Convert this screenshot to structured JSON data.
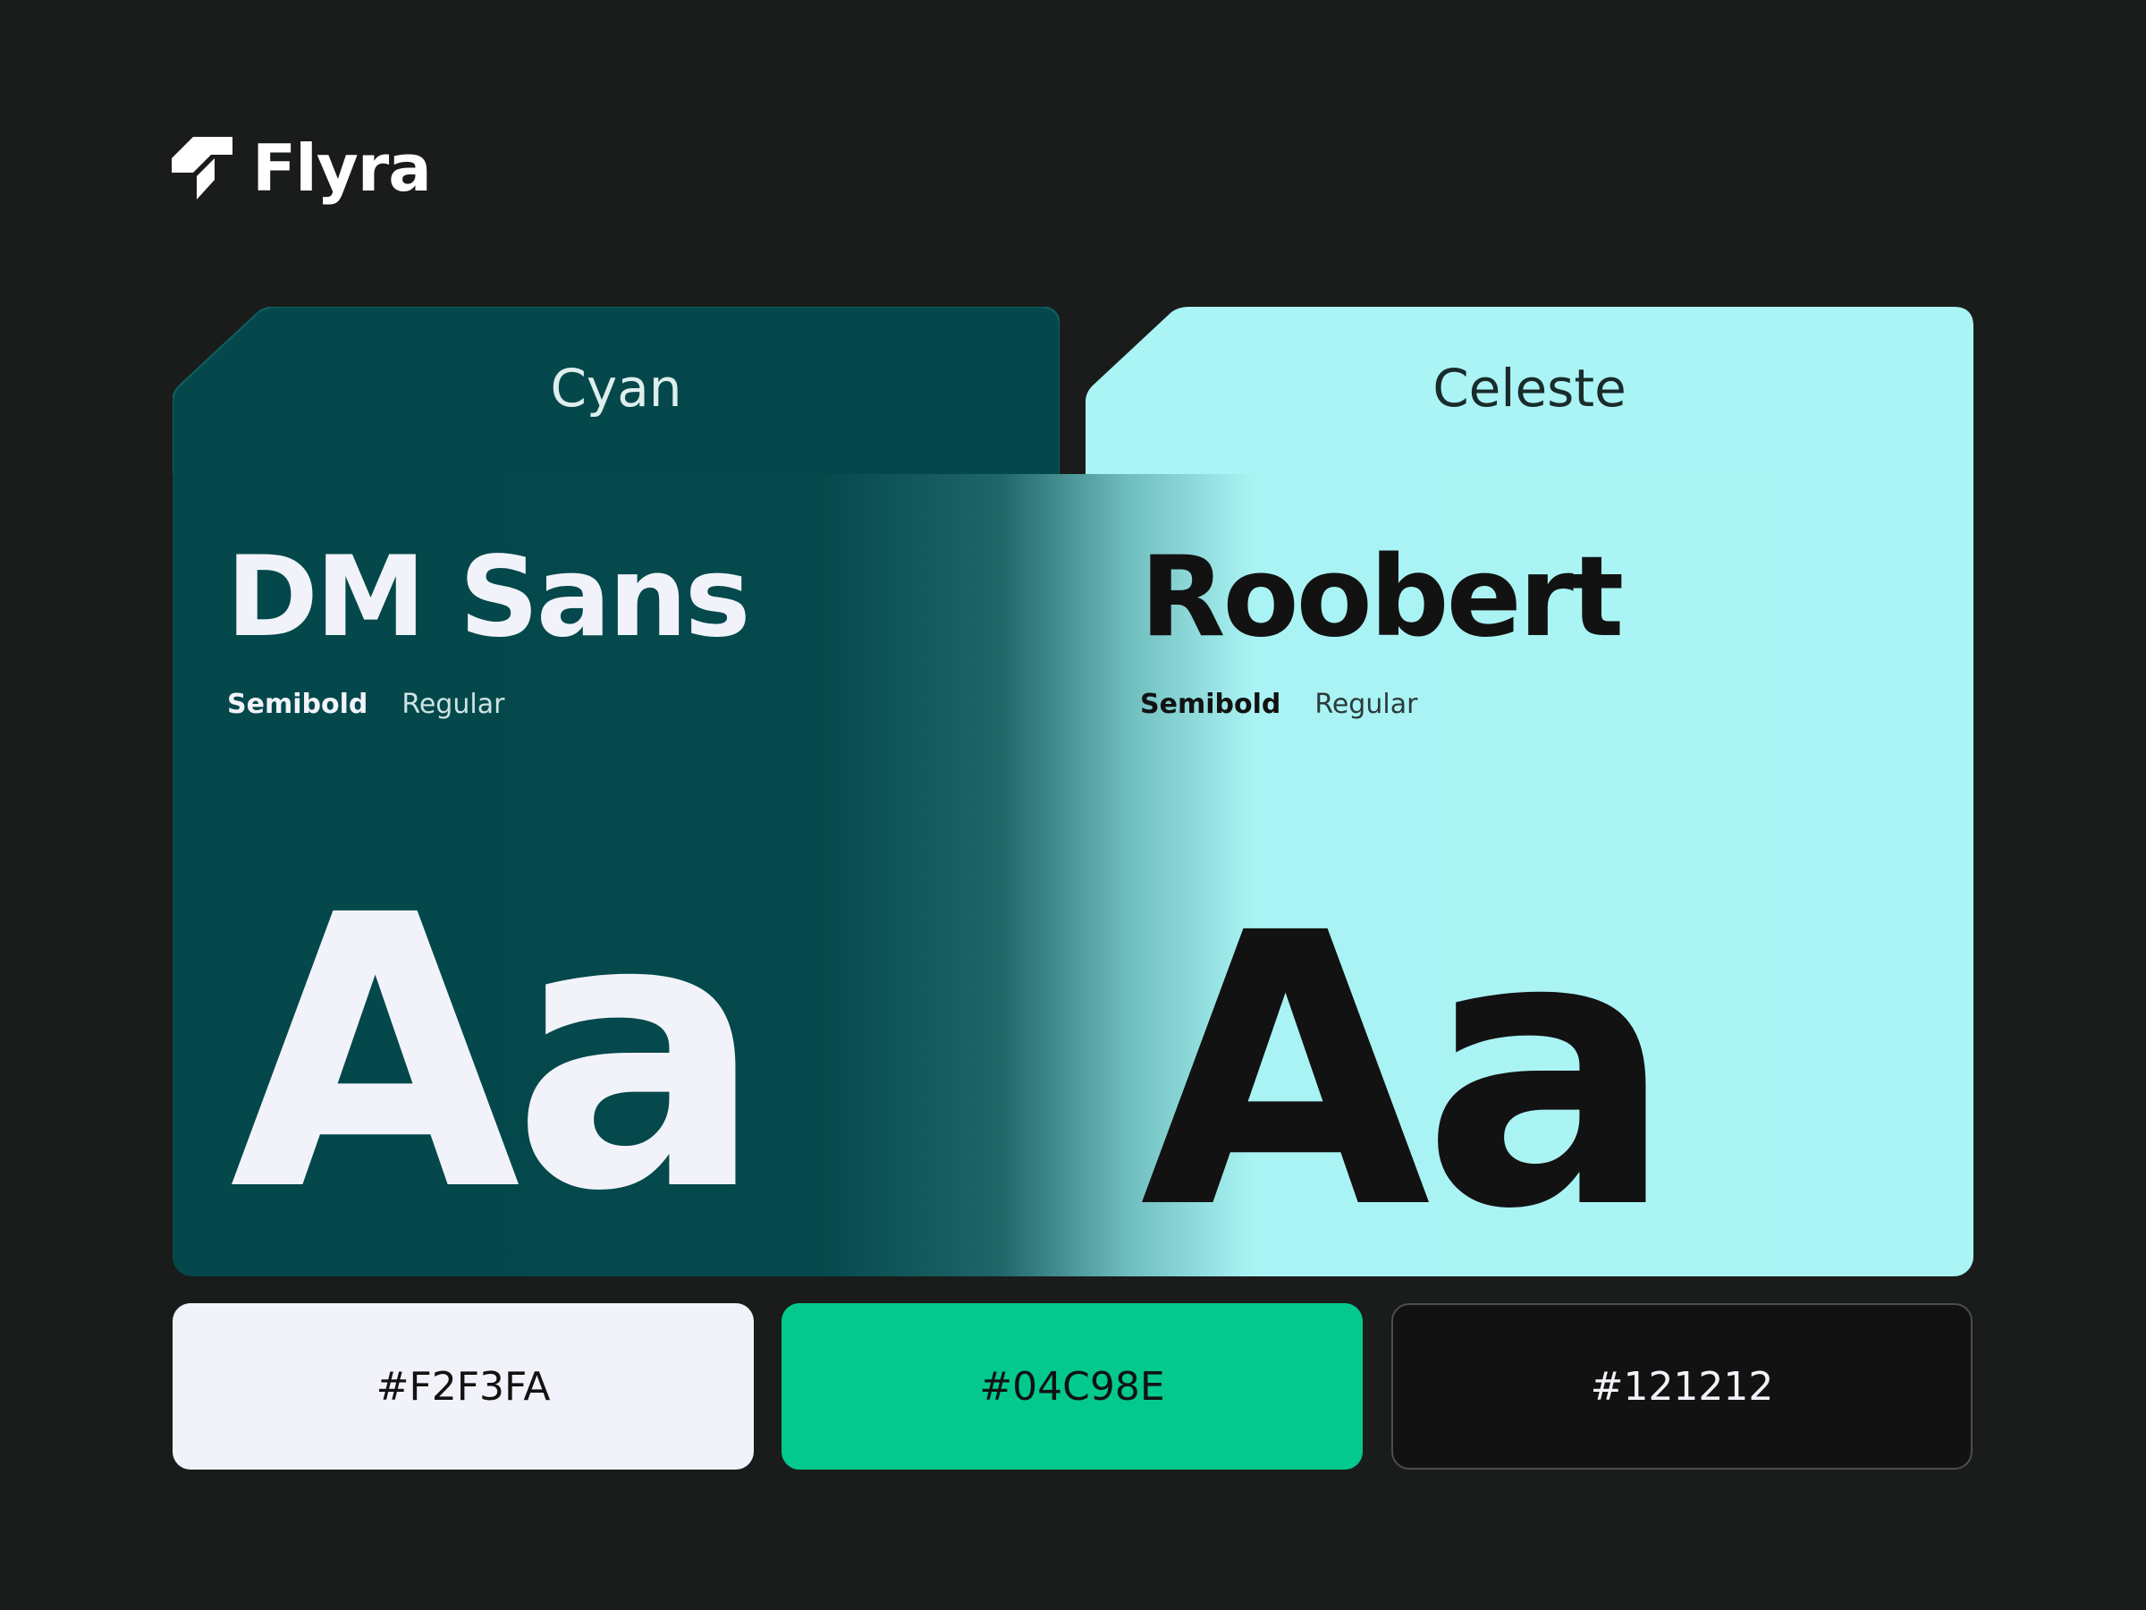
{
  "brand": {
    "name": "Flyra",
    "icon": "flyra-logo-icon"
  },
  "tabs": [
    {
      "label": "Cyan",
      "color": "#04484b"
    },
    {
      "label": "Celeste",
      "color": "#abf4f5"
    }
  ],
  "fonts": [
    {
      "name": "DM Sans",
      "weights": [
        "Semibold",
        "Regular"
      ],
      "sample": "Aa",
      "text_color": "#F2F3FA"
    },
    {
      "name": "Roobert",
      "weights": [
        "Semibold",
        "Regular"
      ],
      "sample": "Aa",
      "text_color": "#121212"
    }
  ],
  "swatches": [
    {
      "hex": "#F2F3FA"
    },
    {
      "hex": "#04C98E"
    },
    {
      "hex": "#121212"
    }
  ]
}
